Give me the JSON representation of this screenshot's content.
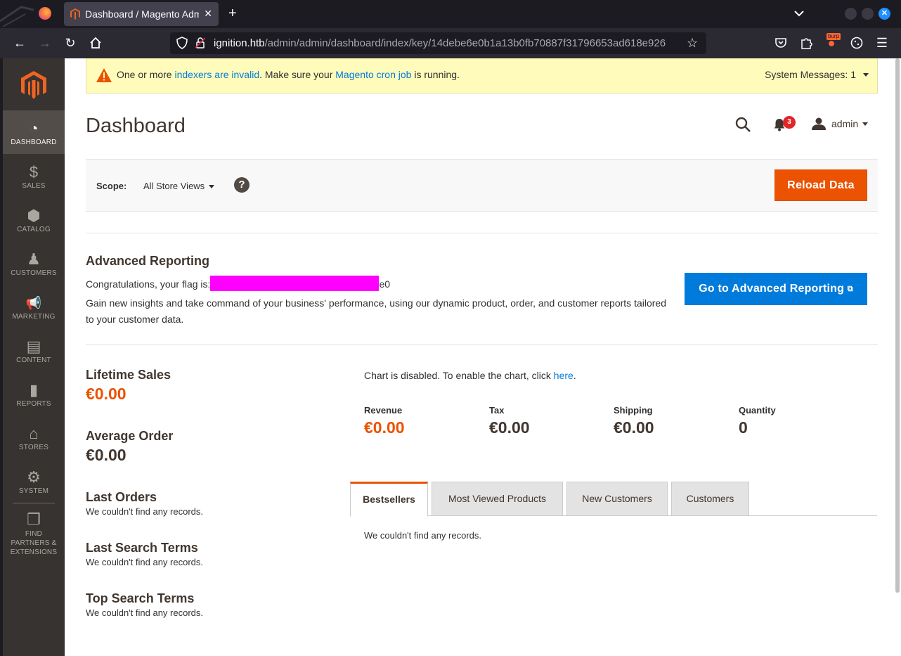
{
  "browser": {
    "tab_title": "Dashboard / Magento Admin",
    "tab_close": "✕",
    "new_tab": "+",
    "url_host": "ignition.htb",
    "url_path": "/admin/admin/dashboard/index/key/14debe6e0b1a13b0fb70887f31796653ad618e926",
    "burp_label": "burp"
  },
  "sidebar": {
    "items": [
      {
        "label": "DASHBOARD",
        "icon": "dashboard-gauge-icon",
        "glyph": "◔"
      },
      {
        "label": "SALES",
        "icon": "dollar-icon",
        "glyph": "$"
      },
      {
        "label": "CATALOG",
        "icon": "box-icon",
        "glyph": "⬢"
      },
      {
        "label": "CUSTOMERS",
        "icon": "person-icon",
        "glyph": "♟"
      },
      {
        "label": "MARKETING",
        "icon": "megaphone-icon",
        "glyph": "📢"
      },
      {
        "label": "CONTENT",
        "icon": "layout-icon",
        "glyph": "▤"
      },
      {
        "label": "REPORTS",
        "icon": "bar-chart-icon",
        "glyph": "▮"
      },
      {
        "label": "STORES",
        "icon": "store-icon",
        "glyph": "⌂"
      },
      {
        "label": "SYSTEM",
        "icon": "gear-icon",
        "glyph": "⚙"
      },
      {
        "label": "FIND PARTNERS & EXTENSIONS",
        "icon": "blocks-icon",
        "glyph": "❒"
      }
    ]
  },
  "notice": {
    "prefix": "One or more ",
    "link1": "indexers are invalid",
    "middle": ". Make sure your ",
    "link2": "Magento cron job",
    "suffix": " is running.",
    "system_messages": "System Messages: 1"
  },
  "header": {
    "title": "Dashboard",
    "notification_count": "3",
    "user": "admin"
  },
  "scope": {
    "label": "Scope:",
    "value": "All Store Views",
    "help": "?",
    "reload_button": "Reload Data"
  },
  "advanced_reporting": {
    "title": "Advanced Reporting",
    "flag_prefix": "Congratulations, your flag is:",
    "flag_suffix": "e0",
    "description": "Gain new insights and take command of your business' performance, using our dynamic product, order, and customer reports tailored to your customer data.",
    "button": "Go to Advanced Reporting",
    "button_icon": "⧉"
  },
  "stats": {
    "lifetime_sales_label": "Lifetime Sales",
    "lifetime_sales_value": "€0.00",
    "average_order_label": "Average Order",
    "average_order_value": "€0.00"
  },
  "lists": {
    "last_orders": "Last Orders",
    "last_search_terms": "Last Search Terms",
    "top_search_terms": "Top Search Terms",
    "empty": "We couldn't find any records."
  },
  "chart": {
    "note_prefix": "Chart is disabled. To enable the chart, click ",
    "note_link": "here",
    "note_suffix": "."
  },
  "totals": [
    {
      "label": "Revenue",
      "value": "€0.00"
    },
    {
      "label": "Tax",
      "value": "€0.00"
    },
    {
      "label": "Shipping",
      "value": "€0.00"
    },
    {
      "label": "Quantity",
      "value": "0"
    }
  ],
  "tabs": [
    {
      "label": "Bestsellers",
      "active": true
    },
    {
      "label": "Most Viewed Products",
      "active": false
    },
    {
      "label": "New Customers",
      "active": false
    },
    {
      "label": "Customers",
      "active": false
    }
  ],
  "tab_content_empty": "We couldn't find any records.",
  "colors": {
    "accent": "#eb5202",
    "link": "#007bdb",
    "sidebar": "#373330",
    "notice_bg": "#fffbbb"
  }
}
